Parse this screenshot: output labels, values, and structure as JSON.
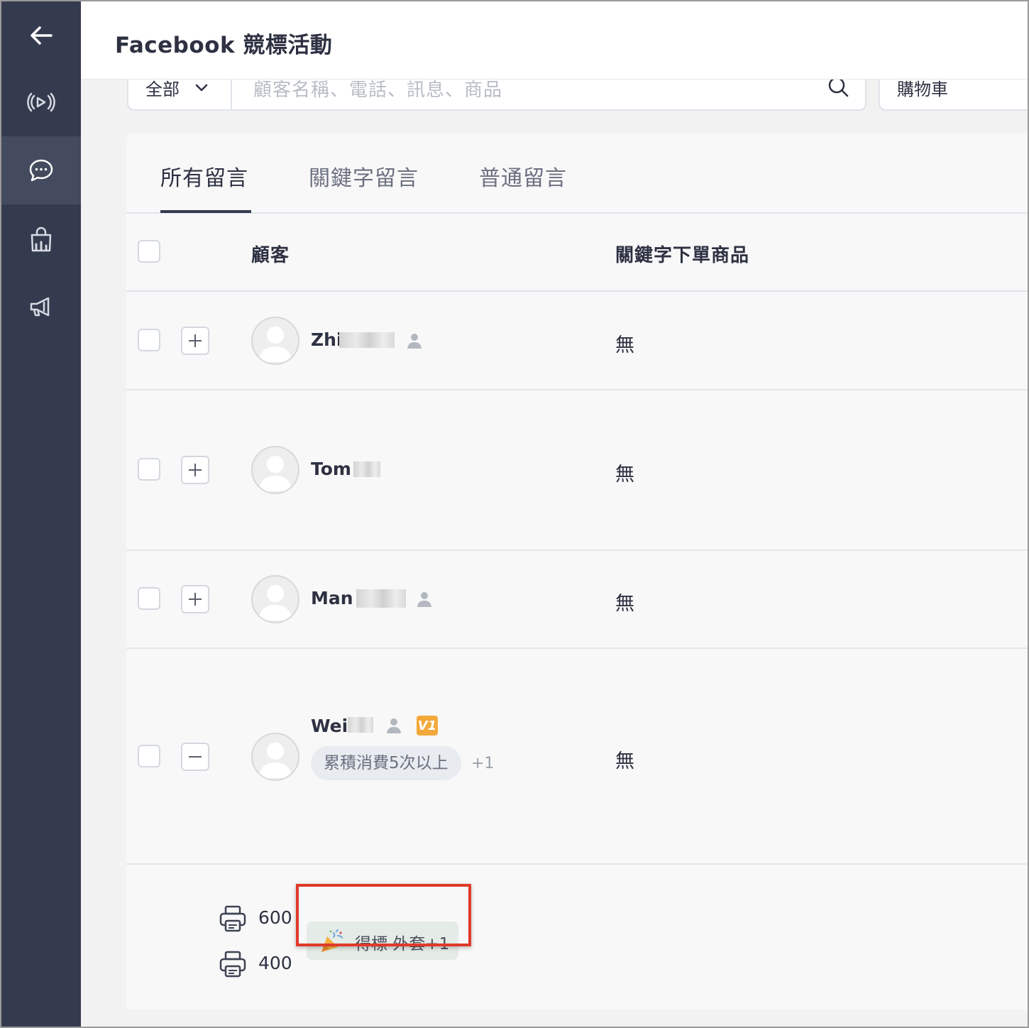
{
  "header": {
    "title": "Facebook 競標活動"
  },
  "sidebar": {
    "items": [
      {
        "icon": "back-arrow-icon"
      },
      {
        "icon": "live-broadcast-icon"
      },
      {
        "icon": "comment-bubble-icon",
        "active": true
      },
      {
        "icon": "shopping-bag-icon"
      },
      {
        "icon": "megaphone-icon"
      }
    ]
  },
  "search": {
    "filter_label": "全部",
    "placeholder": "顧客名稱、電話、訊息、商品",
    "cart_label": "購物車"
  },
  "tabs": [
    "所有留言",
    "關鍵字留言",
    "普通留言"
  ],
  "table": {
    "headers": {
      "customer": "顧客",
      "keyword_products": "關鍵字下單商品"
    },
    "rows": [
      {
        "name": "Zhi",
        "keyword_products": "無",
        "expanded": false
      },
      {
        "name": "Tom",
        "keyword_products": "無",
        "expanded": false
      },
      {
        "name": "Man",
        "keyword_products": "無",
        "expanded": false
      },
      {
        "name": "Wei",
        "keyword_products": "無",
        "expanded": true,
        "vip": "V1",
        "tag": "累積消費5次以上",
        "tag_more": "+1"
      }
    ]
  },
  "expanded": {
    "prices": [
      "600",
      "400"
    ],
    "win_badge": "得標 外套+1"
  },
  "colors": {
    "sidebar": "#353b4f",
    "highlight": "#e03a2a",
    "vip": "#f2a93b"
  }
}
